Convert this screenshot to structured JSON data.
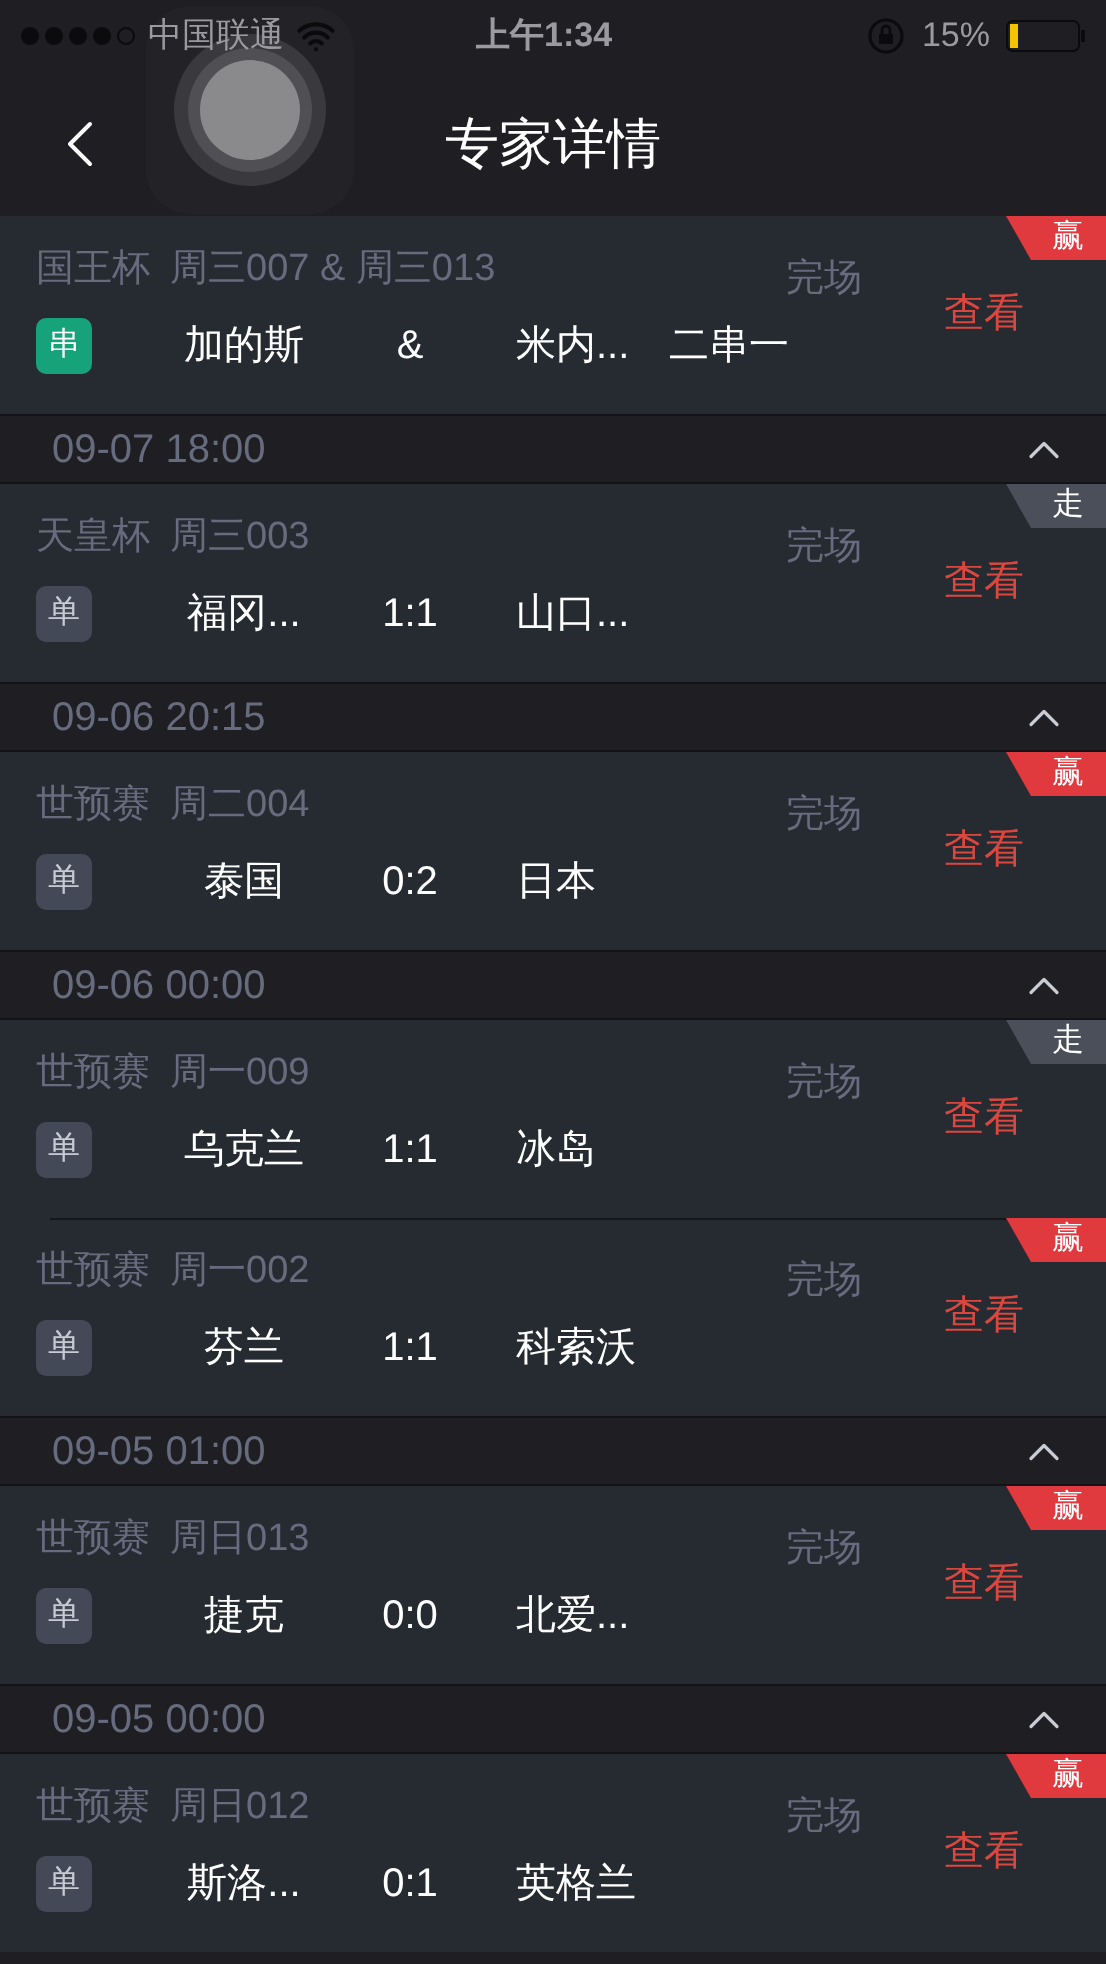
{
  "status_bar": {
    "carrier": "中国联通",
    "time": "上午1:34",
    "battery": "15%"
  },
  "nav": {
    "title": "专家详情"
  },
  "sections": [
    {
      "cards": [
        {
          "league": "国王杯",
          "match_no": "周三007 & 周三013",
          "status": "完场",
          "kind": "parlay",
          "type_label": "串",
          "home": "加的斯",
          "score": "&",
          "away": "米内...",
          "extra": "二串一",
          "result": "赢",
          "color": "#e0393e",
          "action": "查看"
        }
      ]
    },
    {
      "header": "09-07 18:00",
      "expanded": true,
      "cards": [
        {
          "league": "天皇杯",
          "match_no": "周三003",
          "status": "完场",
          "kind": "single",
          "type_label": "单",
          "home": "福冈...",
          "score": "1:1",
          "away": "山口...",
          "result": "走",
          "color": "#4a4f5a",
          "action": "查看"
        }
      ]
    },
    {
      "header": "09-06 20:15",
      "expanded": true,
      "cards": [
        {
          "league": "世预赛",
          "match_no": "周二004",
          "status": "完场",
          "kind": "single",
          "type_label": "单",
          "home": "泰国",
          "score": "0:2",
          "away": "日本",
          "result": "赢",
          "color": "#e0393e",
          "action": "查看"
        }
      ]
    },
    {
      "header": "09-06 00:00",
      "expanded": true,
      "cards": [
        {
          "league": "世预赛",
          "match_no": "周一009",
          "status": "完场",
          "kind": "single",
          "type_label": "单",
          "home": "乌克兰",
          "score": "1:1",
          "away": "冰岛",
          "result": "走",
          "color": "#4a4f5a",
          "action": "查看"
        },
        {
          "league": "世预赛",
          "match_no": "周一002",
          "status": "完场",
          "kind": "single",
          "type_label": "单",
          "home": "芬兰",
          "score": "1:1",
          "away": "科索沃",
          "result": "赢",
          "color": "#e0393e",
          "action": "查看"
        }
      ]
    },
    {
      "header": "09-05 01:00",
      "expanded": true,
      "cards": [
        {
          "league": "世预赛",
          "match_no": "周日013",
          "status": "完场",
          "kind": "single",
          "type_label": "单",
          "home": "捷克",
          "score": "0:0",
          "away": "北爱...",
          "result": "赢",
          "color": "#e0393e",
          "action": "查看"
        }
      ]
    },
    {
      "header": "09-05 00:00",
      "expanded": true,
      "cards": [
        {
          "league": "世预赛",
          "match_no": "周日012",
          "status": "完场",
          "kind": "single",
          "type_label": "单",
          "home": "斯洛...",
          "score": "0:1",
          "away": "英格兰",
          "result": "赢",
          "color": "#e0393e",
          "action": "查看"
        }
      ]
    }
  ]
}
